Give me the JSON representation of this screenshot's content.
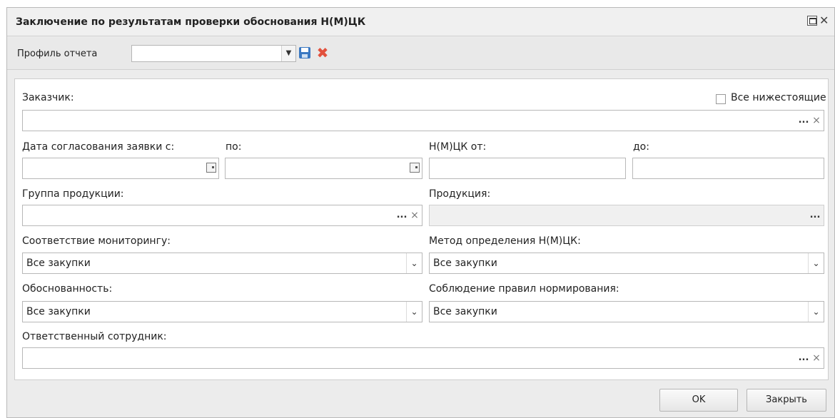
{
  "window": {
    "title": "Заключение по результатам проверки обоснования Н(М)ЦК",
    "maximize_icon": "maximize-icon",
    "close_icon": "close-icon",
    "close_glyph": "✕"
  },
  "profile": {
    "label": "Профиль отчета",
    "value": "",
    "dropdown_glyph": "▼",
    "delete_glyph": "✖"
  },
  "form": {
    "customer": {
      "label": "Заказчик:",
      "value": ""
    },
    "all_subordinate": {
      "label": "Все нижестоящие",
      "checked": false
    },
    "approval_date_from": {
      "label": "Дата согласования заявки с:",
      "value": ""
    },
    "approval_date_to": {
      "label": "по:",
      "value": ""
    },
    "nmck_from": {
      "label": "Н(М)ЦК от:",
      "value": ""
    },
    "nmck_to": {
      "label": "до:",
      "value": ""
    },
    "product_group": {
      "label": "Группа продукции:",
      "value": ""
    },
    "product": {
      "label": "Продукция:",
      "value": ""
    },
    "monitoring": {
      "label": "Соответствие мониторингу:",
      "value": "Все закупки"
    },
    "nmck_method": {
      "label": "Метод определения Н(М)ЦК:",
      "value": "Все закупки"
    },
    "justification": {
      "label": "Обоснованность:",
      "value": "Все закупки"
    },
    "norm_rules": {
      "label": "Соблюдение правил нормирования:",
      "value": "Все закупки"
    },
    "responsible": {
      "label": "Ответственный сотрудник:",
      "value": ""
    },
    "dots_glyph": "...",
    "clear_glyph": "×",
    "select_arrow_glyph": "⌄"
  },
  "footer": {
    "ok_label": "OK",
    "close_label": "Закрыть"
  },
  "colors": {
    "delete_icon": "#e2513d",
    "save_icon": "#3a78c2"
  }
}
